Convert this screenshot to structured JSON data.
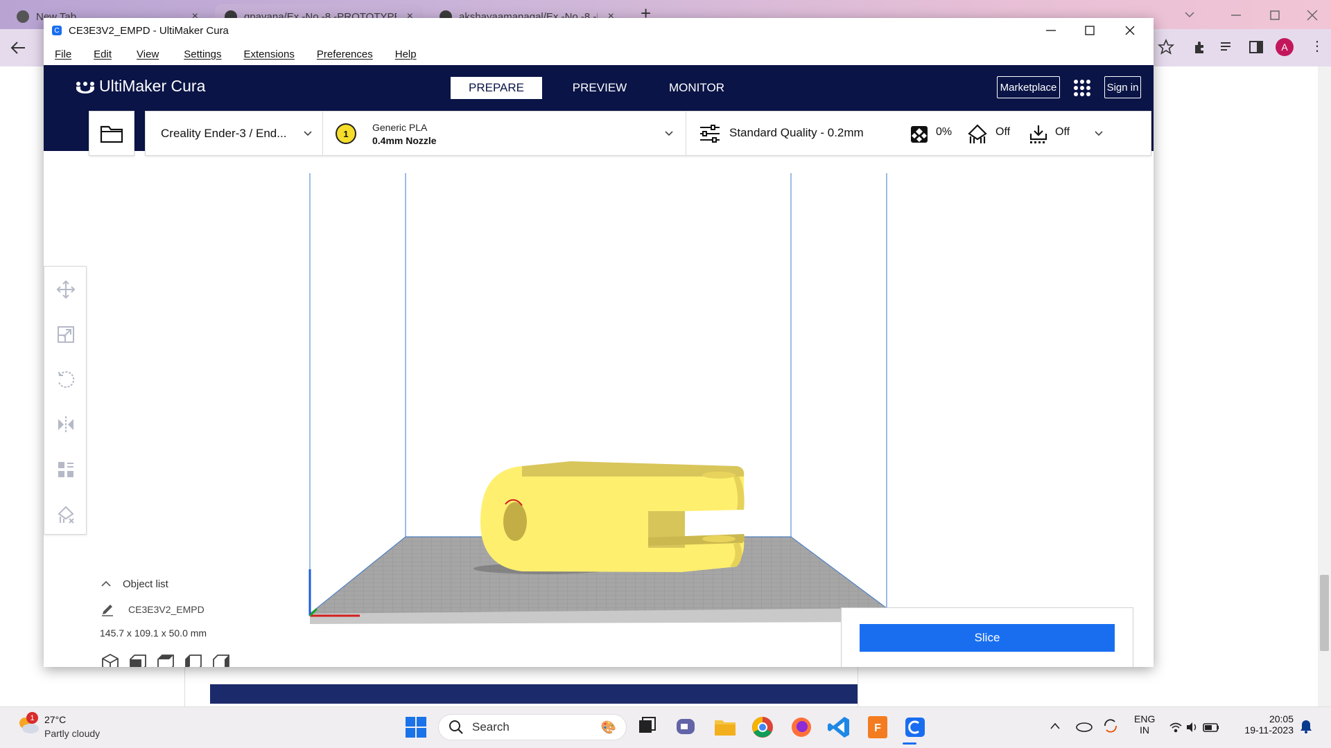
{
  "browser": {
    "tabs": [
      {
        "title": "New Tab",
        "close": "×"
      },
      {
        "title": "gpavana/Ex.-No.-8.-PROTOTYPE",
        "close": "×"
      },
      {
        "title": "akshayaamanagal/Ex.-No.-8.-PR...",
        "close": "×"
      }
    ],
    "new_tab": "+",
    "profile_initial": "A"
  },
  "window": {
    "title": "CE3E3V2_EMPD - UltiMaker Cura"
  },
  "menu": [
    "File",
    "Edit",
    "View",
    "Settings",
    "Extensions",
    "Preferences",
    "Help"
  ],
  "header": {
    "logo": "UltiMaker Cura",
    "stages": [
      "PREPARE",
      "PREVIEW",
      "MONITOR"
    ],
    "active_stage": "PREPARE",
    "marketplace": "Marketplace",
    "sign_in": "Sign in"
  },
  "printer": {
    "name": "Creality Ender-3 / End...",
    "extruder_number": "1",
    "material": "Generic PLA",
    "nozzle": "0.4mm Nozzle"
  },
  "print_settings": {
    "profile": "Standard Quality - 0.2mm",
    "infill": "0%",
    "support": "Off",
    "adhesion": "Off"
  },
  "object_list": {
    "title": "Object list",
    "object_name": "CE3E3V2_EMPD",
    "dimensions": "145.7 x 109.1 x 50.0 mm"
  },
  "slice": {
    "label": "Slice"
  },
  "taskbar": {
    "weather_badge": "1",
    "temperature": "27°C",
    "weather": "Partly cloudy",
    "search_placeholder": "Search",
    "lang_line1": "ENG",
    "lang_line2": "IN",
    "time": "20:05",
    "date": "19-11-2023"
  },
  "colors": {
    "header_bg": "#0a1446",
    "accent": "#196ef0",
    "model": "#ffef6e",
    "build_plate": "#a6a6a6"
  }
}
